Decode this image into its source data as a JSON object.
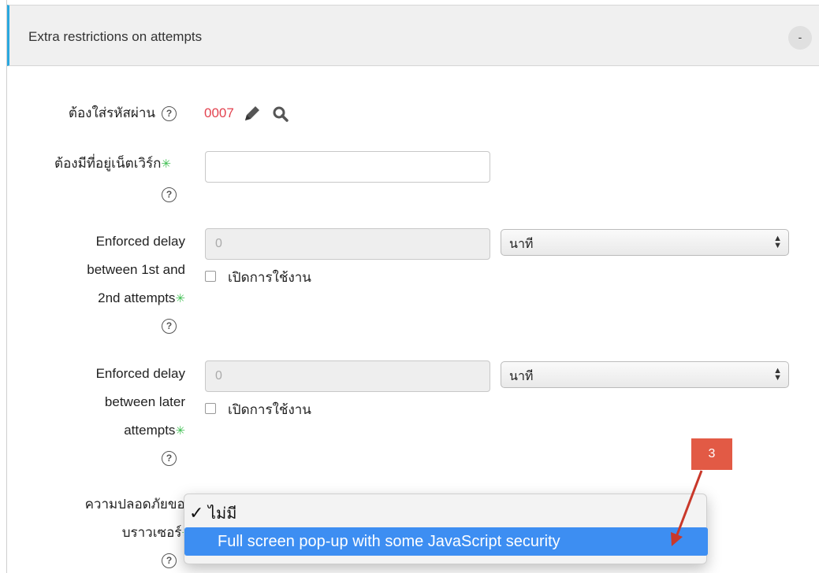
{
  "section": {
    "title": "Extra restrictions on attempts",
    "collapse_label": "-"
  },
  "password": {
    "label": "ต้องใส่รหัสผ่าน",
    "value": "0007"
  },
  "network": {
    "label": "ต้องมีที่อยู่เน็ตเวิร์ก",
    "value": ""
  },
  "delay1": {
    "label_line1": "Enforced delay",
    "label_line2": "between 1st and",
    "label_line3": "2nd attempts",
    "value": "0",
    "unit": "นาที",
    "enable_label": "เปิดการใช้งาน"
  },
  "delay2": {
    "label_line1": "Enforced delay",
    "label_line2": "between later",
    "label_line3": "attempts",
    "value": "0",
    "unit": "นาที",
    "enable_label": "เปิดการใช้งาน"
  },
  "browser_security": {
    "label_line1": "ความปลอดภัยของ",
    "label_line2": "บราวเซอร์",
    "options": [
      "ไม่มี",
      "Full screen pop-up with some JavaScript security"
    ],
    "checked_option": "ไม่มี",
    "highlighted_option": "Full screen pop-up with some JavaScript security"
  },
  "annotation": {
    "step_number": "3",
    "color": "#e25a45"
  },
  "colors": {
    "accent": "#2aa8df",
    "password_value": "#e3424f",
    "required_marker": "#3fbf52",
    "highlight": "#3d8ef2"
  },
  "icons": [
    "help-icon",
    "pencil-icon",
    "search-icon",
    "required-asterisk-icon",
    "select-arrows-icon",
    "checkmark-icon"
  ]
}
